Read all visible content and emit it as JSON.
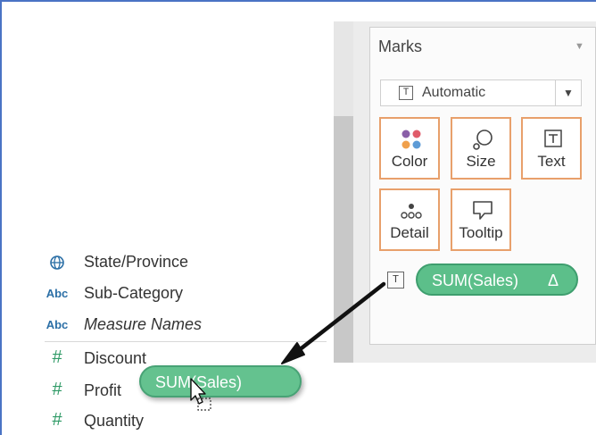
{
  "marks": {
    "title": "Marks",
    "mark_type": "Automatic",
    "mark_type_icon": "T",
    "buttons": [
      {
        "label": "Color",
        "icon": "color-dots-icon"
      },
      {
        "label": "Size",
        "icon": "size-icon"
      },
      {
        "label": "Text",
        "icon": "text-icon"
      },
      {
        "label": "Detail",
        "icon": "detail-dots-icon"
      },
      {
        "label": "Tooltip",
        "icon": "tooltip-icon"
      }
    ],
    "shelf_pill": {
      "label": "SUM(Sales)",
      "delta": "Δ",
      "icon": "T"
    }
  },
  "data_pane": {
    "fields": [
      {
        "label": "State/Province",
        "icon": "globe-icon"
      },
      {
        "label": "Sub-Category",
        "icon": "Abc"
      },
      {
        "label": "Measure Names",
        "icon": "Abc"
      },
      {
        "label": "Discount",
        "icon": "#"
      },
      {
        "label": "Profit",
        "icon": "#"
      },
      {
        "label": "Quantity",
        "icon": "#"
      }
    ]
  },
  "dragged_pill": {
    "label": "SUM(Sales)"
  },
  "colors": {
    "pill_green": "#5cbf8a",
    "button_border": "#e8a06b",
    "frame_blue": "#4a73c4"
  }
}
